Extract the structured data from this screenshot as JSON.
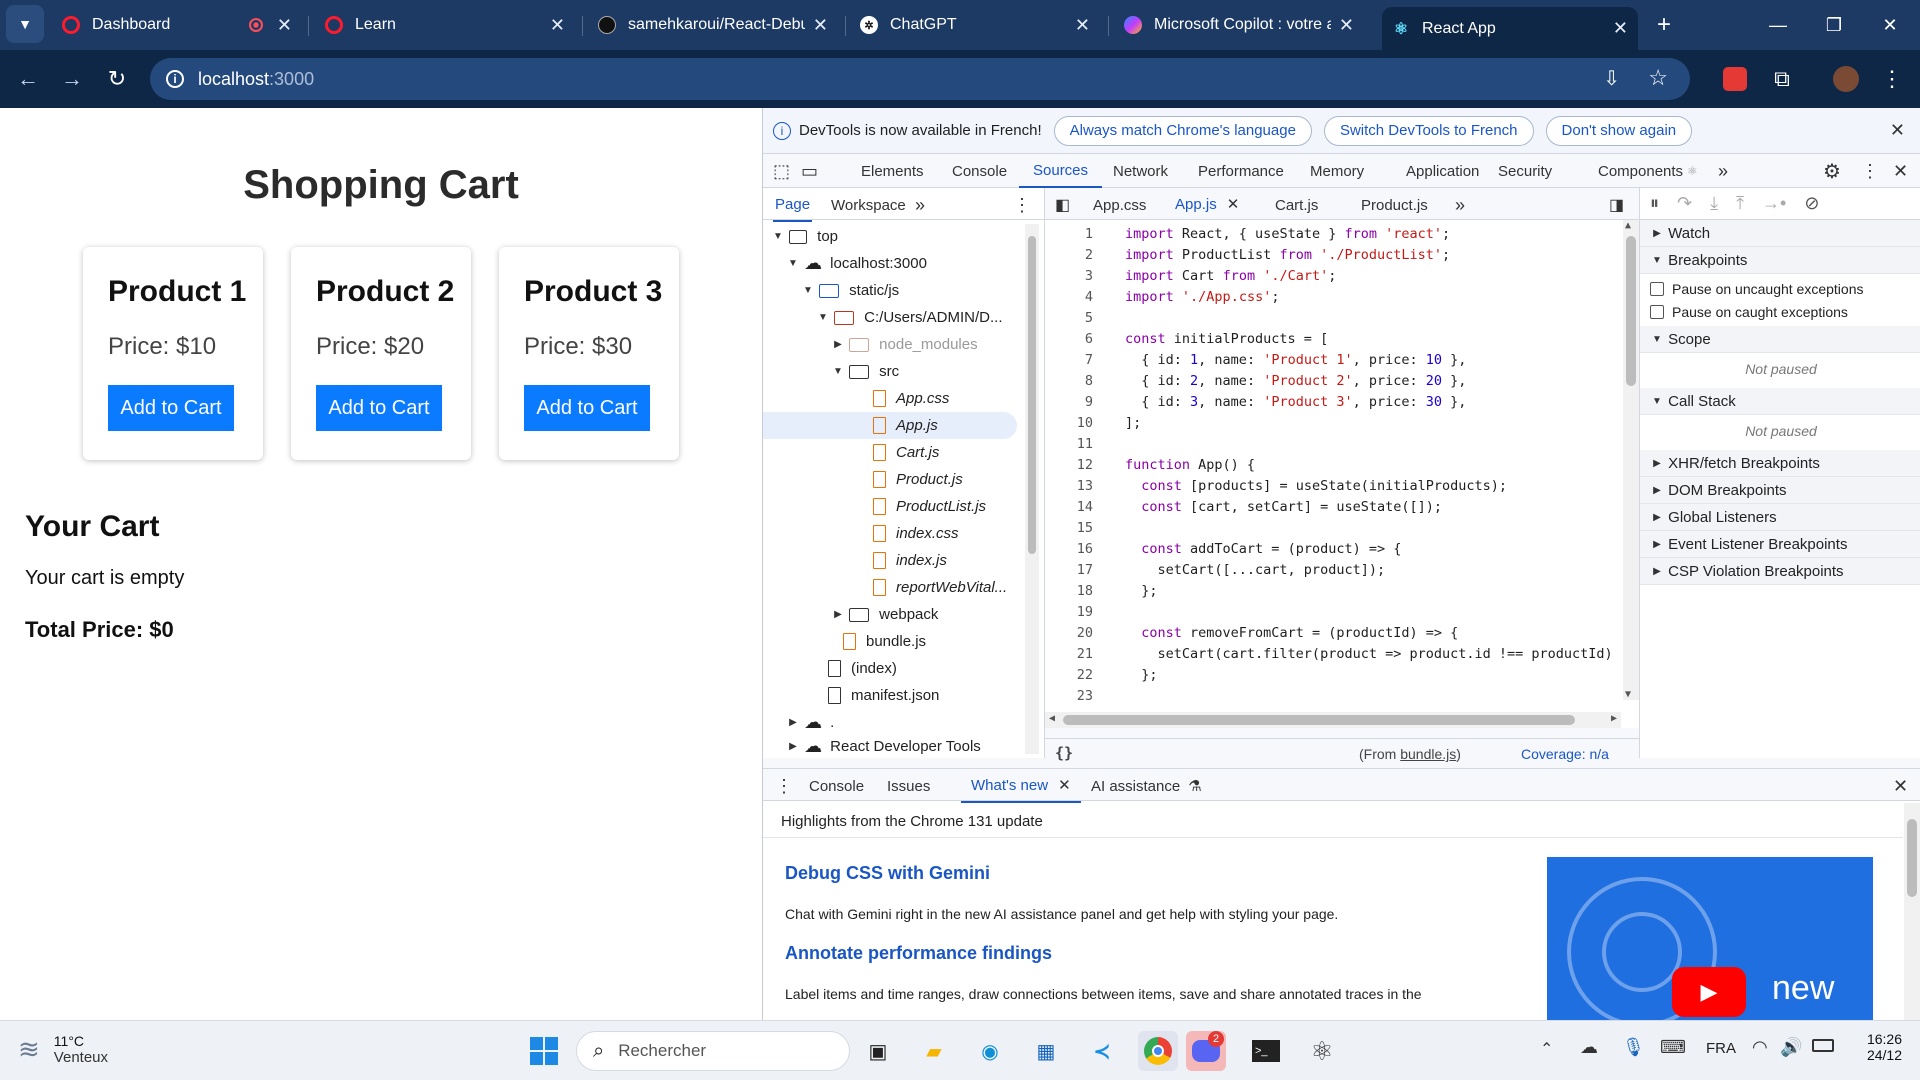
{
  "browser": {
    "tabs": [
      {
        "title": "Dashboard",
        "favicon": "opera-icon"
      },
      {
        "title": "Learn",
        "favicon": "opera-icon"
      },
      {
        "title": "samehkaroui/React-Debug",
        "favicon": "github-icon"
      },
      {
        "title": "ChatGPT",
        "favicon": "chatgpt-icon"
      },
      {
        "title": "Microsoft Copilot : votre a",
        "favicon": "copilot-icon"
      },
      {
        "title": "React App",
        "favicon": "react-icon"
      }
    ],
    "url_host": "localhost",
    "url_port": ":3000"
  },
  "page": {
    "title": "Shopping Cart",
    "products": [
      {
        "name": "Product 1",
        "price": "Price: $10",
        "button": "Add to Cart"
      },
      {
        "name": "Product 2",
        "price": "Price: $20",
        "button": "Add to Cart"
      },
      {
        "name": "Product 3",
        "price": "Price: $30",
        "button": "Add to Cart"
      }
    ],
    "cart_title": "Your Cart",
    "cart_empty": "Your cart is empty",
    "total": "Total Price: $0"
  },
  "devtools": {
    "infobar": {
      "message": "DevTools is now available in French!",
      "btn_match": "Always match Chrome's language",
      "btn_switch": "Switch DevTools to French",
      "btn_dismiss": "Don't show again"
    },
    "tabs": [
      "Elements",
      "Console",
      "Sources",
      "Network",
      "Performance",
      "Memory",
      "Application",
      "Security",
      "Components"
    ],
    "nav_tabs": [
      "Page",
      "Workspace"
    ],
    "tree": [
      "top",
      "localhost:3000",
      "static/js",
      "C:/Users/ADMIN/D...",
      "node_modules",
      "src",
      "App.css",
      "App.js",
      "Cart.js",
      "Product.js",
      "ProductList.js",
      "index.css",
      "index.js",
      "reportWebVital...",
      "webpack",
      "bundle.js",
      "(index)",
      "manifest.json",
      ".",
      "React Developer Tools"
    ],
    "editor_tabs": [
      "App.css",
      "App.js",
      "Cart.js",
      "Product.js"
    ],
    "line_numbers": [
      "1",
      "2",
      "3",
      "4",
      "5",
      "6",
      "7",
      "8",
      "9",
      "10",
      "11",
      "12",
      "13",
      "14",
      "15",
      "16",
      "17",
      "18",
      "19",
      "20",
      "21",
      "22",
      "23"
    ],
    "code_lines": [
      "import React, { useState } from 'react';",
      "import ProductList from './ProductList';",
      "import Cart from './Cart';",
      "import './App.css';",
      "",
      "const initialProducts = [",
      "  { id: 1, name: 'Product 1', price: 10 },",
      "  { id: 2, name: 'Product 2', price: 20 },",
      "  { id: 3, name: 'Product 3', price: 30 },",
      "];",
      "",
      "function App() {",
      "  const [products] = useState(initialProducts);",
      "  const [cart, setCart] = useState([]);",
      "",
      "  const addToCart = (product) => {",
      "    setCart([...cart, product]);",
      "  };",
      "",
      "  const removeFromCart = (productId) => {",
      "    setCart(cart.filter(product => product.id !== productId)",
      "  };",
      ""
    ],
    "status_from": "(From ",
    "status_file": "bundle.js",
    "status_close": ")",
    "coverage": "Coverage: n/a",
    "debugger": {
      "watch": "Watch",
      "breakpoints": "Breakpoints",
      "pause_uncaught": "Pause on uncaught exceptions",
      "pause_caught": "Pause on caught exceptions",
      "scope": "Scope",
      "not_paused": "Not paused",
      "call_stack": "Call Stack",
      "xhr": "XHR/fetch Breakpoints",
      "dom": "DOM Breakpoints",
      "global": "Global Listeners",
      "event": "Event Listener Breakpoints",
      "csp": "CSP Violation Breakpoints"
    },
    "drawer": {
      "tabs": [
        "Console",
        "Issues",
        "What's new",
        "AI assistance"
      ],
      "highlight": "Highlights from the Chrome 131 update",
      "h1": "Debug CSS with Gemini",
      "p1": "Chat with Gemini right in the new AI assistance panel and get help with styling your page.",
      "h2": "Annotate performance findings",
      "p2": "Label items and time ranges, draw connections between items, save and share annotated traces in the",
      "image_label": "new"
    }
  },
  "taskbar": {
    "weather_temp": "11°C",
    "weather_desc": "Venteux",
    "search": "Rechercher",
    "lang": "FRA",
    "time": "16:26",
    "date": "24/12",
    "discord_badge": "2"
  },
  "colors": {
    "tabstrip": "#1c3a63",
    "toolbar": "#0f2747",
    "button_blue": "#0a7bff",
    "devtools_accent": "#1a56c4"
  }
}
